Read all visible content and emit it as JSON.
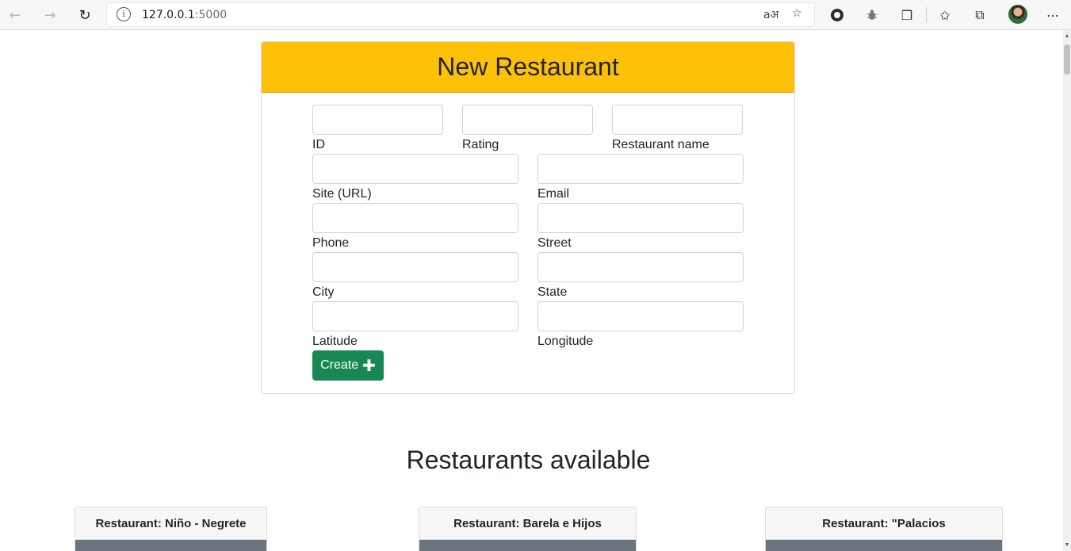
{
  "browser": {
    "url_host": "127.0.0.1",
    "url_port": ":5000"
  },
  "form": {
    "title": "New Restaurant",
    "fields": {
      "id": {
        "label": "ID",
        "value": ""
      },
      "rating": {
        "label": "Rating",
        "value": ""
      },
      "name": {
        "label": "Restaurant name",
        "value": ""
      },
      "site": {
        "label": "Site (URL)",
        "value": ""
      },
      "email": {
        "label": "Email",
        "value": ""
      },
      "phone": {
        "label": "Phone",
        "value": ""
      },
      "street": {
        "label": "Street",
        "value": ""
      },
      "city": {
        "label": "City",
        "value": ""
      },
      "state": {
        "label": "State",
        "value": ""
      },
      "lat": {
        "label": "Latitude",
        "value": ""
      },
      "lng": {
        "label": "Longitude",
        "value": ""
      }
    },
    "submit_label": "Create",
    "submit_color": "#198754",
    "header_color": "#ffc107"
  },
  "restaurants": {
    "title": "Restaurants available",
    "cards": [
      {
        "header": "Restaurant: Niño - Negrete"
      },
      {
        "header": "Restaurant: Barela e Hijos"
      },
      {
        "header": "Restaurant: \"Palacios"
      }
    ]
  }
}
